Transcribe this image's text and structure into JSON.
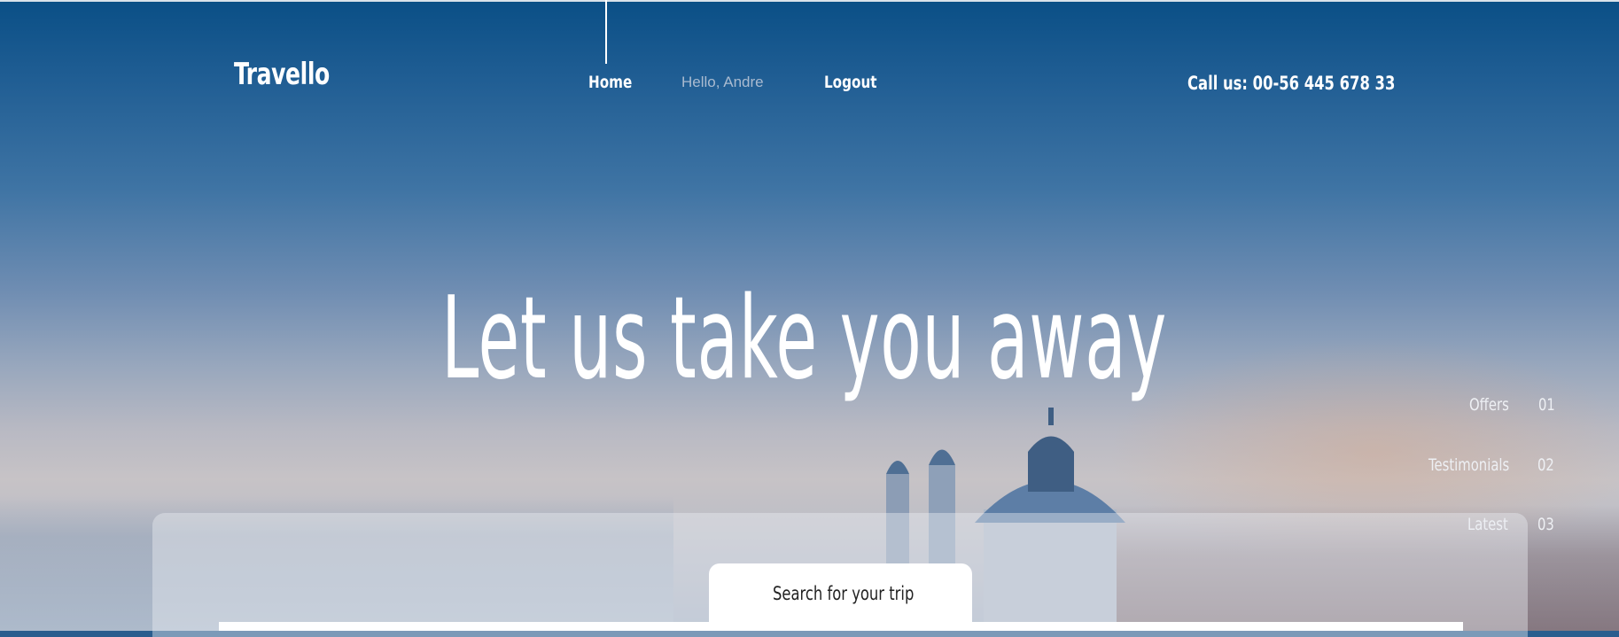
{
  "header": {
    "brand": "Travello",
    "nav": {
      "home_label": "Home",
      "greeting": "Hello, Andre",
      "logout_label": "Logout"
    },
    "call_us": "Call us: 00-56 445 678 33"
  },
  "hero": {
    "headline": "Let us take you away"
  },
  "side_nav": {
    "items": [
      {
        "label": "Offers",
        "number": "01"
      },
      {
        "label": "Testimonials",
        "number": "02"
      },
      {
        "label": "Latest",
        "number": "03"
      }
    ]
  },
  "search": {
    "tab_label": "Search for your trip"
  }
}
